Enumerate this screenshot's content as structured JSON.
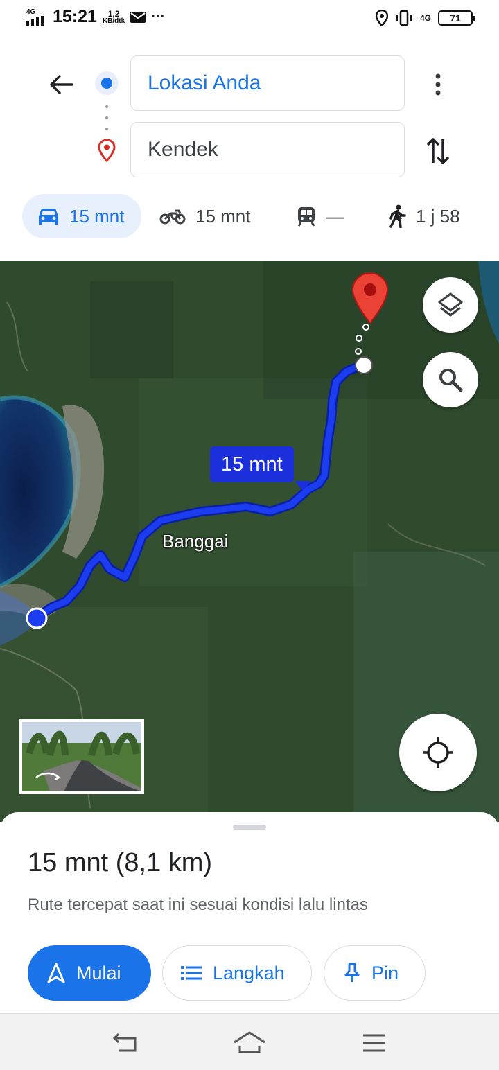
{
  "status_bar": {
    "network": "4G",
    "time": "15:21",
    "speed_value": "1,2",
    "speed_unit": "KB/dtk",
    "more": "···",
    "network_right": "4G",
    "battery": "71"
  },
  "header": {
    "origin_value": "Lokasi Anda",
    "destination_value": "Kendek"
  },
  "modes": [
    {
      "name": "car",
      "label": "15 mnt",
      "icon": "car-icon",
      "active": true
    },
    {
      "name": "motorcycle",
      "label": "15 mnt",
      "icon": "motorcycle-icon"
    },
    {
      "name": "transit",
      "label": "—",
      "icon": "train-icon"
    },
    {
      "name": "walk",
      "label": "1 j 58",
      "icon": "walk-icon"
    }
  ],
  "map": {
    "route_time_label": "15 mnt",
    "place_label": "Banggai",
    "route_color": "#1c3cf0"
  },
  "sheet": {
    "summary": "15 mnt (8,1 km)",
    "subtitle": "Rute tercepat saat ini sesuai kondisi lalu lintas",
    "start_label": "Mulai",
    "steps_label": "Langkah",
    "pin_label": "Pin"
  },
  "colors": {
    "accent": "#1a73e8",
    "destination_pin": "#d93025"
  }
}
